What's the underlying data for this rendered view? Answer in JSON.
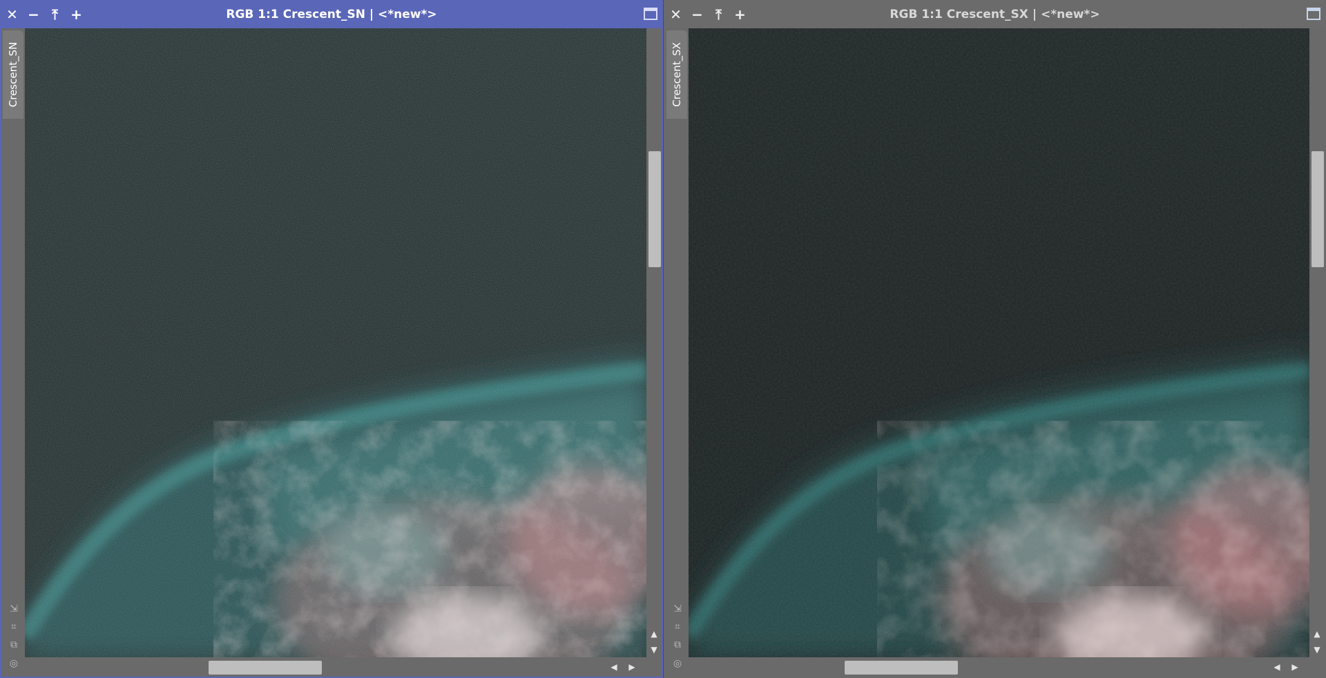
{
  "windows": [
    {
      "id": "left",
      "title": "RGB 1:1 Crescent_SN | <*new*>",
      "side_tab": "Crescent_SN",
      "active": true,
      "accent": "#5a66b8"
    },
    {
      "id": "right",
      "title": "RGB 1:1 Crescent_SX | <*new*>",
      "side_tab": "Crescent_SX",
      "active": false,
      "accent": "#6b6b6b"
    }
  ],
  "titlebar_icons": [
    "close-icon",
    "minimize-icon",
    "shade-icon",
    "expand-icon",
    "maximize-icon"
  ],
  "side_tools": [
    "zoom-fit-icon",
    "fit-view-icon",
    "clone-view-icon",
    "target-icon"
  ],
  "colors": {
    "nebula_teal": "#3d9593",
    "nebula_pink": "#d98a8e",
    "sky_dark": "#1c2323"
  }
}
